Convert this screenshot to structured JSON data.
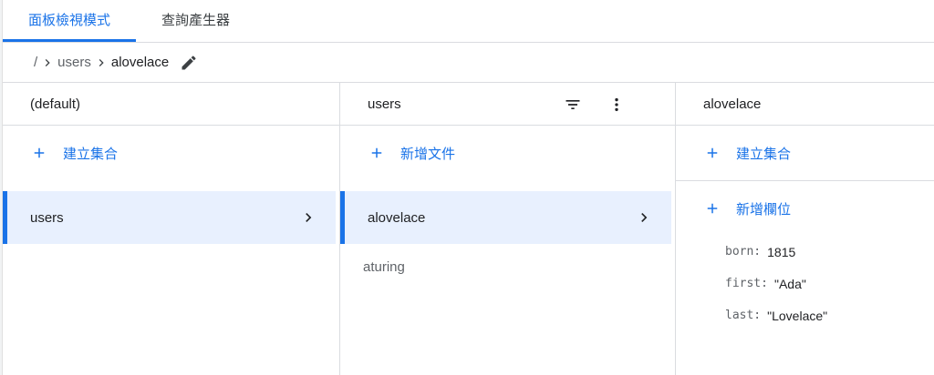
{
  "tabs": [
    {
      "label": "面板檢視模式",
      "active": true
    },
    {
      "label": "查詢產生器",
      "active": false
    }
  ],
  "breadcrumb": {
    "root": "/",
    "items": [
      "users",
      "alovelace"
    ],
    "icons": [
      "chevron-right-icon",
      "pencil-icon"
    ]
  },
  "columns": {
    "root": {
      "header": "(default)",
      "action": "建立集合",
      "items": [
        "users"
      ],
      "selected": "users"
    },
    "collection": {
      "header": "users",
      "header_icons": [
        "filter-icon",
        "more-vert-icon"
      ],
      "action": "新增文件",
      "items": [
        "alovelace",
        "aturing"
      ],
      "selected": "alovelace"
    },
    "document": {
      "header": "alovelace",
      "action_collection": "建立集合",
      "action_field": "新增欄位",
      "fields": [
        {
          "name": "born:",
          "value": "1815"
        },
        {
          "name": "first:",
          "value": "\"Ada\""
        },
        {
          "name": "last:",
          "value": "\"Lovelace\""
        }
      ]
    }
  },
  "colors": {
    "accent": "#1a73e8",
    "selected_bg": "#e8f0fe",
    "border": "#dadce0"
  }
}
